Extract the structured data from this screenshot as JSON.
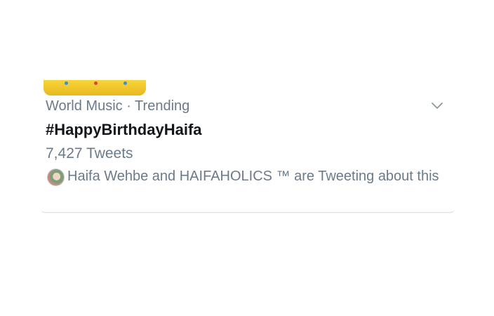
{
  "trend": {
    "context": "World Music · Trending",
    "hashtag": "#HappyBirthdayHaifa",
    "tweet_count": "7,427 Tweets",
    "social_proof": "Haifa Wehbe and HAIFAHOLICS ™ are Tweeting about this"
  },
  "icons": {
    "banner": "crown-banner-image",
    "caret": "chevron-down-icon",
    "avatar": "user-avatar"
  },
  "colors": {
    "meta_text": "#6b7a8a",
    "hashtag_text": "#14171a",
    "crown_gold": "#f0c62e",
    "crown_gem_blue": "#3b8fd6",
    "crown_gem_red": "#d8453a"
  }
}
